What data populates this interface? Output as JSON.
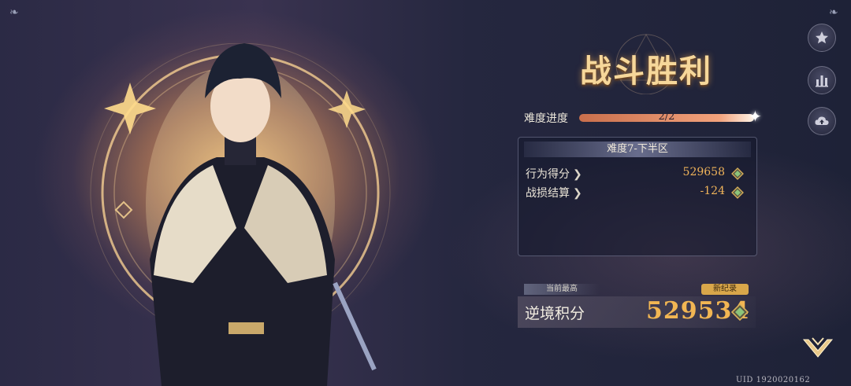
{
  "result": {
    "title": "战斗胜利",
    "progress": {
      "label": "难度进度",
      "text": "2/2",
      "fraction": 1.0
    },
    "panel": {
      "heading": "难度7-下半区",
      "rows": [
        {
          "label": "行为得分",
          "value": "529658"
        },
        {
          "label": "战损结算",
          "value": "-124"
        }
      ]
    },
    "best": {
      "tag": "当前最高",
      "badge": "新纪录",
      "label": "逆境积分",
      "value": "529534"
    }
  },
  "side_buttons": [
    {
      "icon": "star-icon"
    },
    {
      "icon": "bar-chart-icon"
    },
    {
      "icon": "cloud-upload-icon"
    }
  ],
  "continue_icon": "chevron-down-icon",
  "uid": "UID 1920020162",
  "colors": {
    "accent_gold": "#f0b45a",
    "title": "#f6d79a",
    "progress": "#f2a27c"
  }
}
